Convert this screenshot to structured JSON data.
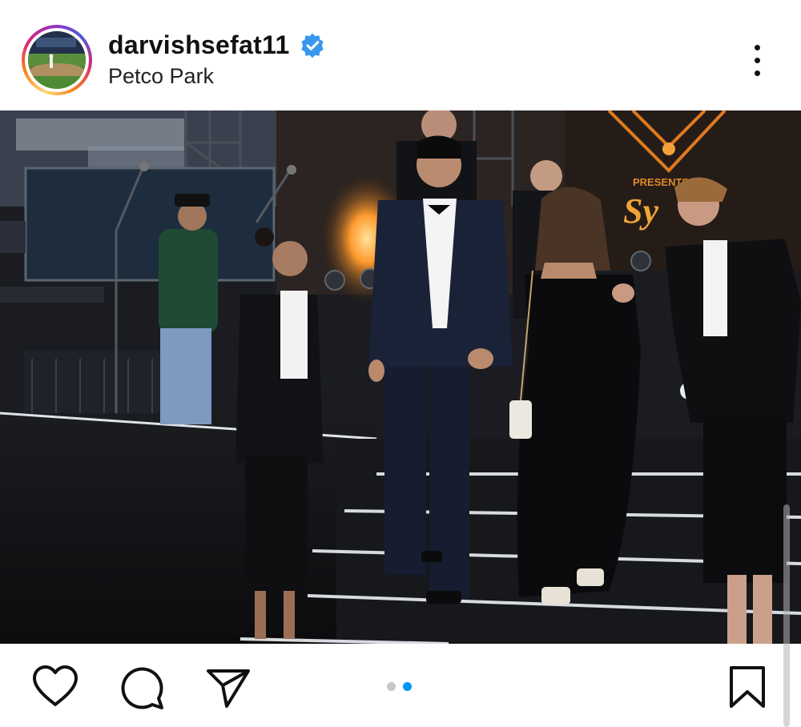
{
  "post": {
    "username": "darvishsefat11",
    "location": "Petco Park",
    "verified": true,
    "verified_color": "#3897f0"
  },
  "header": {
    "avatar_icon": "profile-avatar",
    "more_icon": "more-vertical-icon"
  },
  "photo": {
    "sign_text": "Sy",
    "sign_small_text": "PRESENTS"
  },
  "actions": {
    "like_icon": "heart-icon",
    "comment_icon": "comment-icon",
    "share_icon": "send-icon",
    "save_icon": "bookmark-icon"
  },
  "carousel": {
    "current": 2,
    "total": 2,
    "active_color": "#0095f6",
    "inactive_color": "#c7c7c7"
  }
}
